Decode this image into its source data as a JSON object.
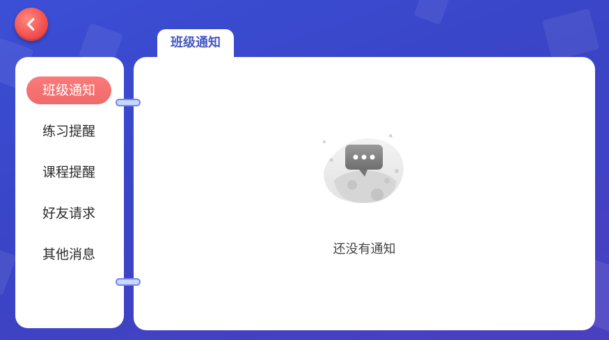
{
  "tab": {
    "label": "班级通知"
  },
  "sidebar": {
    "items": [
      {
        "label": "班级通知",
        "active": true
      },
      {
        "label": "练习提醒",
        "active": false
      },
      {
        "label": "课程提醒",
        "active": false
      },
      {
        "label": "好友请求",
        "active": false
      },
      {
        "label": "其他消息",
        "active": false
      }
    ]
  },
  "main": {
    "empty_message": "还没有通知",
    "empty_icon": "chat-bubble-planet-icon"
  },
  "icons": {
    "back": "chevron-left-icon"
  },
  "colors": {
    "background": "#3b4fd6",
    "accent": "#f06a6a",
    "tab_text": "#4659c4",
    "card": "#ffffff"
  }
}
